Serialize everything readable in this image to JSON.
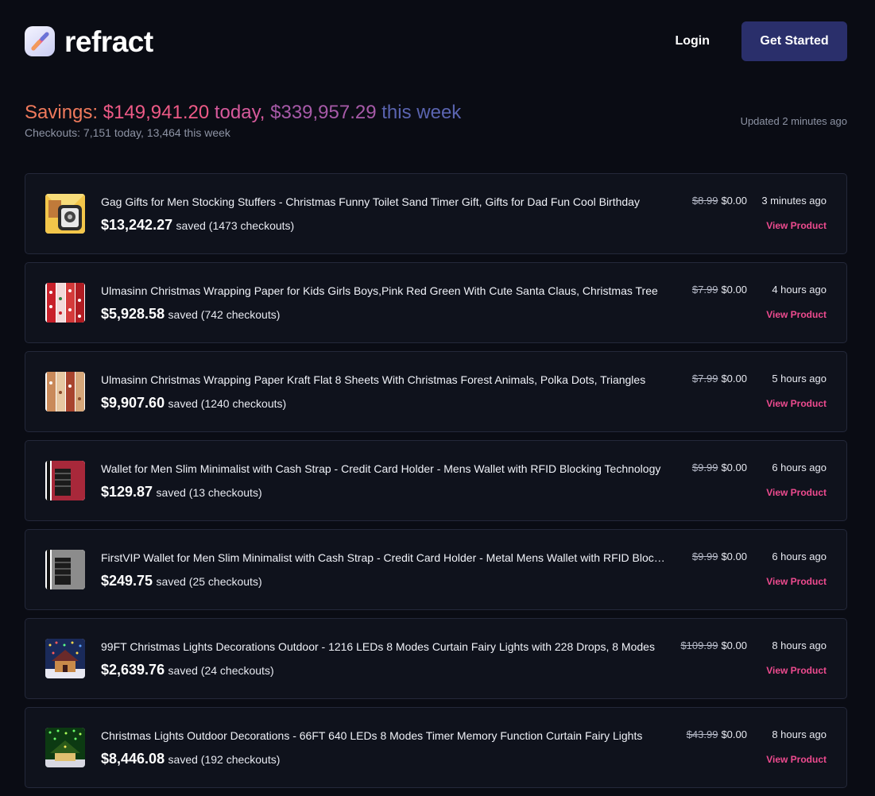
{
  "brand": {
    "name": "refract"
  },
  "nav": {
    "login": "Login",
    "cta": "Get Started"
  },
  "summary": {
    "savings_label": "Savings: ",
    "today_amount": "$149,941.20",
    "today_suffix": " today, ",
    "week_amount": "$339,957.29",
    "week_suffix": " this week",
    "checkouts": "Checkouts: 7,151 today, 13,464 this week",
    "updated": "Updated 2 minutes ago"
  },
  "colors": {
    "accent": "#ee4b8f",
    "cta_bg": "#2a2f6b",
    "background": "#0a0c14",
    "card_bg": "#0f121c"
  },
  "products": [
    {
      "title": "Gag Gifts for Men Stocking Stuffers - Christmas Funny Toilet Sand Timer Gift, Gifts for Dad Fun Cool Birthday",
      "saved_amount": "$13,242.27",
      "saved_text": "saved (1473 checkouts)",
      "old_price": "$8.99",
      "new_price": "$0.00",
      "time": "3 minutes ago",
      "link": "View Product",
      "thumb": "toilet-timer-thumbnail"
    },
    {
      "title": "Ulmasinn Christmas Wrapping Paper for Kids Girls Boys,Pink Red Green With Cute Santa Claus, Christmas Tree",
      "saved_amount": "$5,928.58",
      "saved_text": "saved (742 checkouts)",
      "old_price": "$7.99",
      "new_price": "$0.00",
      "time": "4 hours ago",
      "link": "View Product",
      "thumb": "wrapping-paper-red-thumbnail"
    },
    {
      "title": "Ulmasinn Christmas Wrapping Paper Kraft Flat 8 Sheets With Christmas Forest Animals, Polka Dots, Triangles",
      "saved_amount": "$9,907.60",
      "saved_text": "saved (1240 checkouts)",
      "old_price": "$7.99",
      "new_price": "$0.00",
      "time": "5 hours ago",
      "link": "View Product",
      "thumb": "wrapping-paper-kraft-thumbnail"
    },
    {
      "title": "Wallet for Men Slim Minimalist with Cash Strap - Credit Card Holder - Mens Wallet with RFID Blocking Technology",
      "saved_amount": "$129.87",
      "saved_text": "saved (13 checkouts)",
      "old_price": "$9.99",
      "new_price": "$0.00",
      "time": "6 hours ago",
      "link": "View Product",
      "thumb": "wallet-red-thumbnail"
    },
    {
      "title": "FirstVIP Wallet for Men Slim Minimalist with Cash Strap - Credit Card Holder - Metal Mens Wallet with RFID Blocking",
      "saved_amount": "$249.75",
      "saved_text": "saved (25 checkouts)",
      "old_price": "$9.99",
      "new_price": "$0.00",
      "time": "6 hours ago",
      "link": "View Product",
      "thumb": "wallet-grey-thumbnail"
    },
    {
      "title": "99FT Christmas Lights Decorations Outdoor - 1216 LEDs 8 Modes Curtain Fairy Lights with 228 Drops, 8 Modes",
      "saved_amount": "$2,639.76",
      "saved_text": "saved (24 checkouts)",
      "old_price": "$109.99",
      "new_price": "$0.00",
      "time": "8 hours ago",
      "link": "View Product",
      "thumb": "curtain-lights-thumbnail"
    },
    {
      "title": "Christmas Lights Outdoor Decorations - 66FT 640 LEDs 8 Modes Timer Memory Function Curtain Fairy Lights",
      "saved_amount": "$8,446.08",
      "saved_text": "saved (192 checkouts)",
      "old_price": "$43.99",
      "new_price": "$0.00",
      "time": "8 hours ago",
      "link": "View Product",
      "thumb": "green-lights-thumbnail"
    }
  ]
}
